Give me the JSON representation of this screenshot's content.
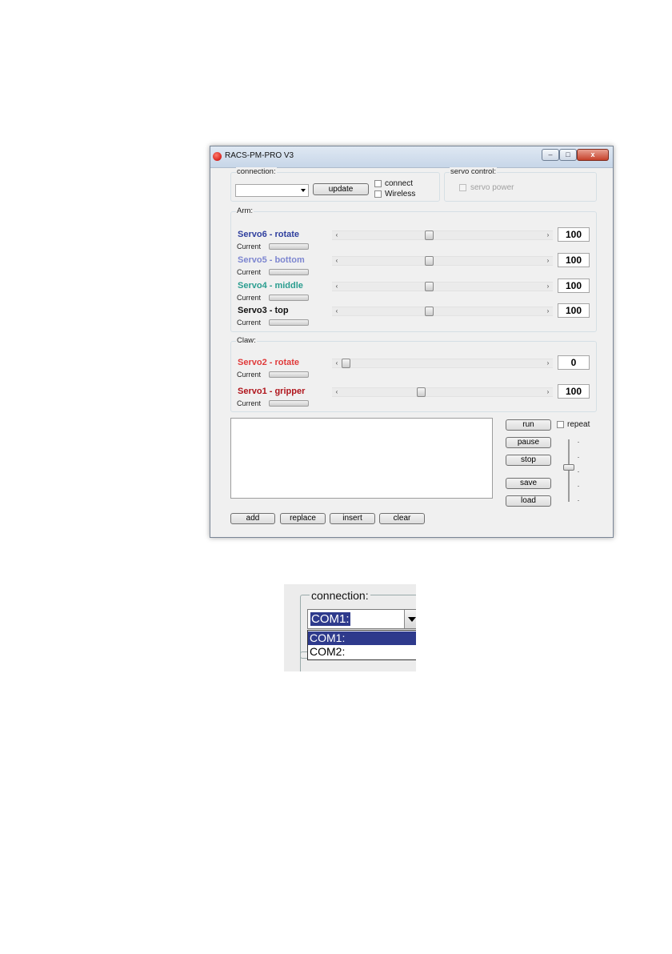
{
  "window": {
    "title": "RACS-PM-PRO V3",
    "controls": {
      "minimize": "–",
      "maximize": "□",
      "close": "x"
    }
  },
  "connection": {
    "legend": "connection:",
    "selected_port": "",
    "update_label": "update",
    "connect_label": "connect",
    "wireless_label": "Wireless"
  },
  "servo_control": {
    "legend": "servo control:",
    "servo_power_label": "servo power"
  },
  "arm": {
    "legend": "Arm:",
    "servos": [
      {
        "name": "Servo6 - rotate",
        "color": "#2f3f9e",
        "current_label": "Current",
        "value": "100",
        "position": 0.43
      },
      {
        "name": "Servo5 - bottom",
        "color": "#7d86d0",
        "current_label": "Current",
        "value": "100",
        "position": 0.43
      },
      {
        "name": "Servo4 - middle",
        "color": "#2a9d8f",
        "current_label": "Current",
        "value": "100",
        "position": 0.43
      },
      {
        "name": "Servo3 - top",
        "color": "#111111",
        "current_label": "Current",
        "value": "100",
        "position": 0.43
      }
    ]
  },
  "claw": {
    "legend": "Claw:",
    "servos": [
      {
        "name": "Servo2 - rotate",
        "color": "#e03a3a",
        "current_label": "Current",
        "value": "0",
        "position": 0.0
      },
      {
        "name": "Servo1 - gripper",
        "color": "#b0151c",
        "current_label": "Current",
        "value": "100",
        "position": 0.39
      }
    ]
  },
  "sequence": {
    "run_label": "run",
    "repeat_label": "repeat",
    "pause_label": "pause",
    "stop_label": "stop",
    "save_label": "save",
    "load_label": "load",
    "add_label": "add",
    "replace_label": "replace",
    "insert_label": "insert",
    "clear_label": "clear",
    "speed_level": 0.55
  },
  "zoom_inset": {
    "legend": "connection:",
    "selected_port": "COM1:",
    "options": [
      "COM1:",
      "COM2:"
    ]
  },
  "colors": {
    "window_bg": "#f0f0f0",
    "selection": "#2e3a8c",
    "close_button": "#c6412a"
  }
}
